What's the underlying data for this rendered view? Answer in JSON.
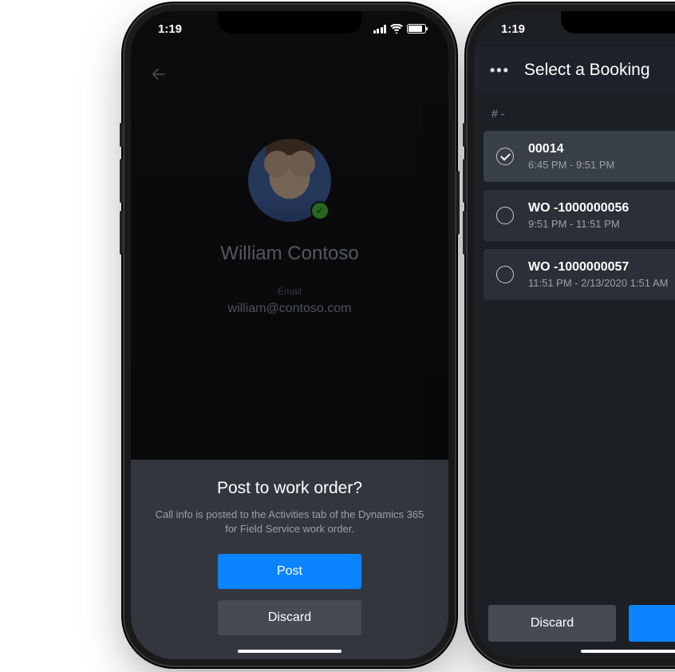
{
  "status": {
    "time": "1:19"
  },
  "left": {
    "profile": {
      "name": "William Contoso",
      "email_label": "Email",
      "email": "william@contoso.com"
    },
    "sheet": {
      "title": "Post to work order?",
      "description": "Call info is posted to the Activities tab of the Dynamics 365 for Field Service work order.",
      "post_label": "Post",
      "discard_label": "Discard"
    }
  },
  "right": {
    "header": {
      "title": "Select a Booking"
    },
    "section_label": "# -",
    "bookings": [
      {
        "title": "00014",
        "time": "6:45 PM - 9:51 PM",
        "selected": true
      },
      {
        "title": "WO -1000000056",
        "time": "9:51 PM - 11:51 PM",
        "selected": false
      },
      {
        "title": "WO -1000000057",
        "time": "11:51 PM - 2/13/2020 1:51 AM",
        "selected": false
      }
    ],
    "discard_label": "Discard"
  }
}
